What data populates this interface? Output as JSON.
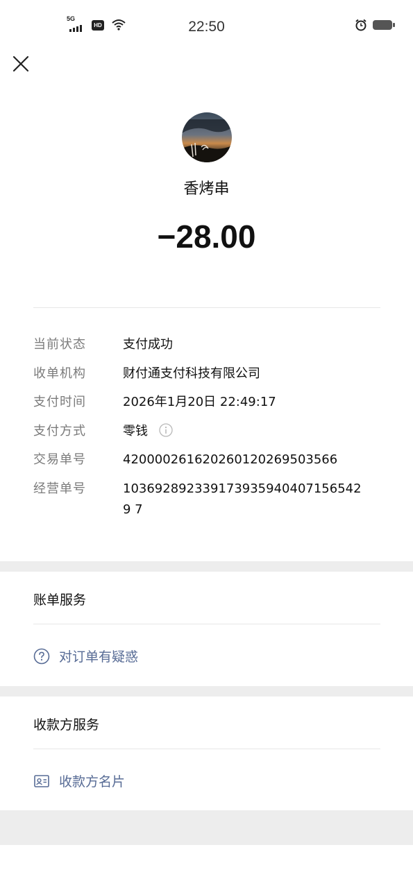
{
  "status_bar": {
    "network": "5G",
    "hd": "HD",
    "time": "22:50"
  },
  "nav": {
    "close_icon": "close-icon"
  },
  "header": {
    "merchant_name": "香烤串",
    "amount": "−28.00"
  },
  "details": [
    {
      "label": "当前状态",
      "value": "支付成功"
    },
    {
      "label": "收单机构",
      "value": "财付通支付科技有限公司"
    },
    {
      "label": "支付时间",
      "value": "2026年1月20日 22:49:17"
    },
    {
      "label": "支付方式",
      "value": "零钱"
    },
    {
      "label": "交易单号",
      "value": "4200002616202601202695035​66"
    },
    {
      "label": "经营单号",
      "value": "1036928923391739359404071565429 7"
    }
  ],
  "bill_service": {
    "title": "账单服务",
    "items": [
      {
        "label": "对订单有疑惑",
        "icon": "question-circle-icon"
      }
    ]
  },
  "payee_service": {
    "title": "收款方服务",
    "items": [
      {
        "label": "收款方名片",
        "icon": "business-card-icon"
      }
    ]
  },
  "colors": {
    "link": "#576b95",
    "label": "#7b7b7b",
    "band": "#ededed"
  }
}
